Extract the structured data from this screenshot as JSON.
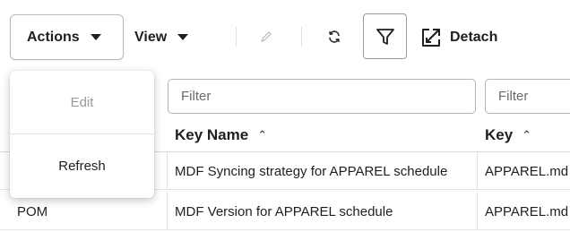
{
  "toolbar": {
    "actions_label": "Actions",
    "view_label": "View",
    "detach_label": "Detach",
    "icons": {
      "edit": "pencil-icon",
      "refresh": "refresh-icon",
      "filter": "filter-icon",
      "detach": "detach-icon"
    }
  },
  "filters": {
    "key_name_placeholder": "Filter",
    "key_placeholder": "Filter"
  },
  "columns": [
    {
      "label": "Key Name"
    },
    {
      "label": "Key"
    }
  ],
  "rows": [
    {
      "id": "",
      "key_name": "MDF Syncing strategy for APPAREL schedule",
      "key": "APPAREL.md"
    },
    {
      "id": "POM",
      "key_name": "MDF Version for APPAREL schedule",
      "key": "APPAREL.md"
    }
  ],
  "actions_menu": {
    "items": [
      {
        "label": "Edit",
        "disabled": true
      },
      {
        "label": "Refresh",
        "disabled": false
      }
    ]
  },
  "colors": {
    "text": "#1f1f1f",
    "disabled_text": "#9a9a9a",
    "border": "#b5b5b5"
  }
}
